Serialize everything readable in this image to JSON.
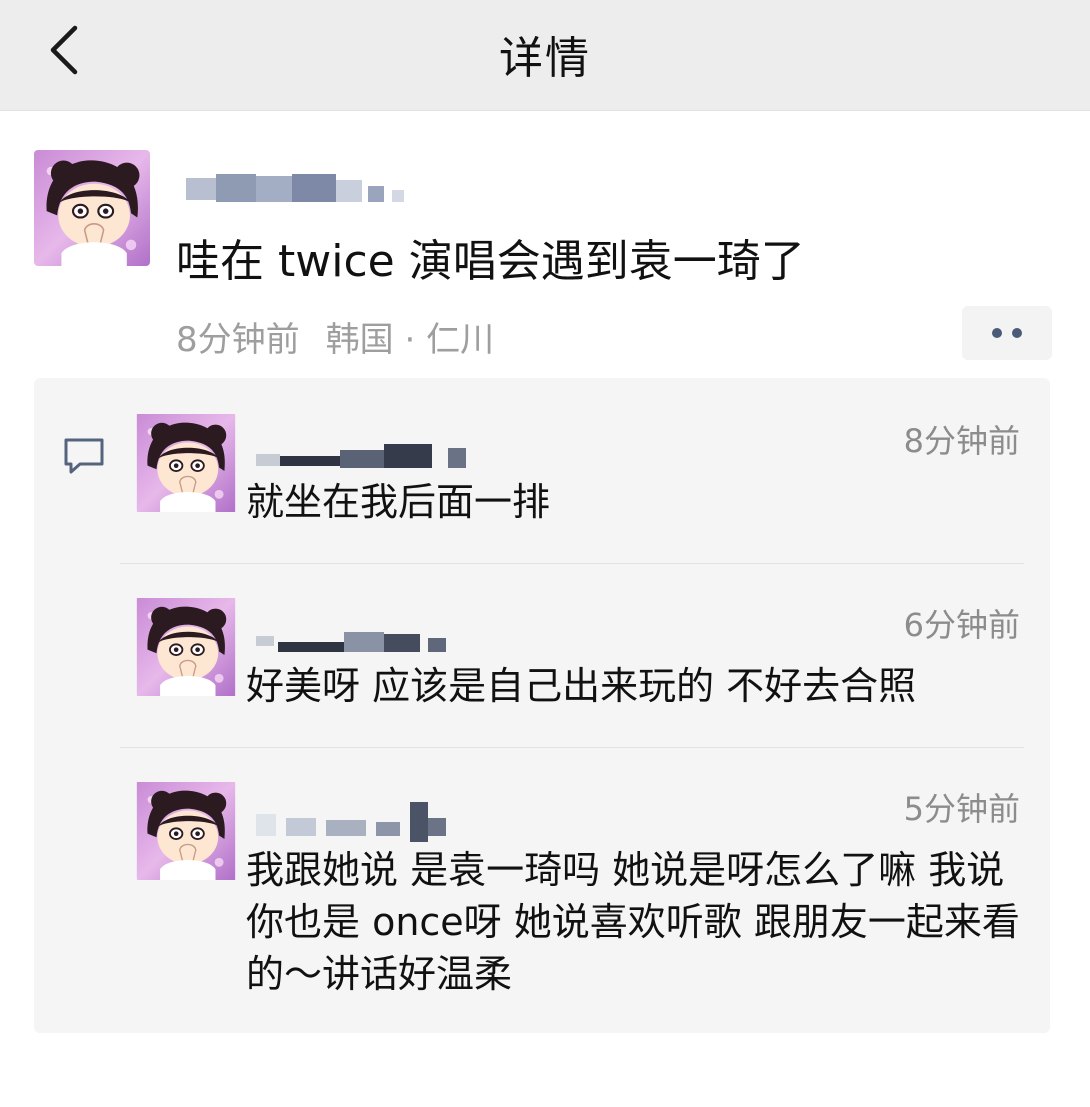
{
  "header": {
    "title": "详情",
    "back_icon": "chevron-left-icon"
  },
  "post": {
    "avatar": "cartoon-girl-avatar",
    "text": "哇在 twice 演唱会遇到袁一琦了",
    "time": "8分钟前",
    "location": "韩国 · 仁川",
    "more_icon": "more-dots-icon"
  },
  "comments": [
    {
      "time": "8分钟前",
      "text": "就坐在我后面一排"
    },
    {
      "time": "6分钟前",
      "text": "好美呀   应该是自己出来玩的 不好去合照"
    },
    {
      "time": "5分钟前",
      "text": "我跟她说 是袁一琦吗 她说是呀怎么了嘛 我说你也是 once呀 她说喜欢听歌 跟朋友一起来看的～讲话好温柔"
    }
  ],
  "colors": {
    "header_bg": "#ededed",
    "comments_bg": "#f5f5f5",
    "meta_gray": "#9e9e9e",
    "link_blue": "#4a5b7a"
  }
}
